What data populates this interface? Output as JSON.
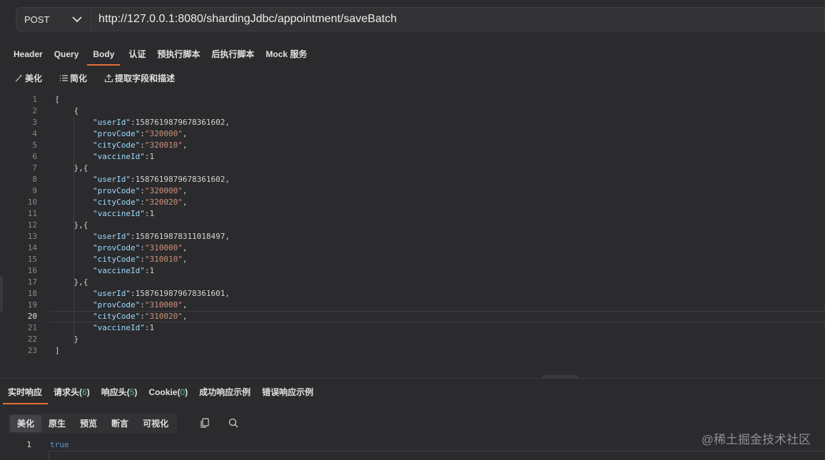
{
  "request": {
    "method": "POST",
    "url": "http://127.0.0.1:8080/shardingJdbc/appointment/saveBatch"
  },
  "request_tabs": [
    "Header",
    "Query",
    "Body",
    "认证",
    "预执行脚本",
    "后执行脚本",
    "Mock 服务"
  ],
  "active_request_tab": "Body",
  "body_toolbar": {
    "beautify": "美化",
    "simplify": "简化",
    "extract": "提取字段和描述"
  },
  "editor": {
    "current_line": 20,
    "lines": [
      "[",
      "    {",
      "        \"userId\":1587619879678361602,",
      "        \"provCode\":\"320000\",",
      "        \"cityCode\":\"320010\",",
      "        \"vaccineId\":1",
      "    },{",
      "        \"userId\":1587619879678361602,",
      "        \"provCode\":\"320000\",",
      "        \"cityCode\":\"320020\",",
      "        \"vaccineId\":1",
      "    },{",
      "        \"userId\":1587619878311018497,",
      "        \"provCode\":\"310000\",",
      "        \"cityCode\":\"310010\",",
      "        \"vaccineId\":1",
      "    },{",
      "        \"userId\":1587619879678361601,",
      "        \"provCode\":\"310000\",",
      "        \"cityCode\":\"310020\",",
      "        \"vaccineId\":1",
      "    }",
      "]"
    ]
  },
  "response_tabs": [
    {
      "label": "实时响应",
      "count": ""
    },
    {
      "label": "请求头",
      "count": "6"
    },
    {
      "label": "响应头",
      "count": "5"
    },
    {
      "label": "Cookie",
      "count": "0"
    },
    {
      "label": "成功响应示例",
      "count": ""
    },
    {
      "label": "错误响应示例",
      "count": ""
    }
  ],
  "active_response_tab": "实时响应",
  "view_modes": [
    "美化",
    "原生",
    "预览",
    "断言",
    "可视化"
  ],
  "active_view_mode": "美化",
  "response": {
    "line_number": "1",
    "body": "true"
  },
  "watermark": "@稀土掘金技术社区",
  "colors": {
    "accent": "#e36f3a",
    "count": "#5bc07a",
    "json_key": "#9cdcfe",
    "json_string": "#ce9178",
    "keyword": "#569cd6"
  }
}
